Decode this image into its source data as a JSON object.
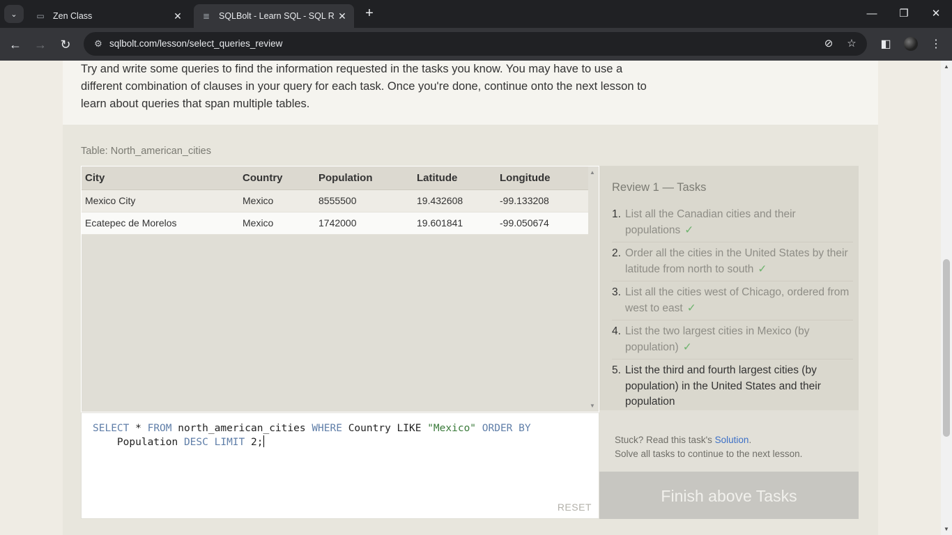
{
  "browser": {
    "tabs": [
      {
        "title": "Zen Class",
        "active": false
      },
      {
        "title": "SQLBolt - Learn SQL - SQL Review",
        "active": true
      }
    ],
    "url": "sqlbolt.com/lesson/select_queries_review"
  },
  "icons": {
    "tab_search": "chevron-down-icon",
    "close": "✕",
    "new_tab": "+",
    "minimize": "—",
    "restore": "❐",
    "window_close": "✕",
    "back": "←",
    "forward": "→",
    "reload": "↻",
    "site_info": "⚙",
    "eye_off": "⊘",
    "star": "☆",
    "side_panel": "◧",
    "menu": "⋮",
    "up_arrow": "▲",
    "down_arrow": "▼"
  },
  "intro": {
    "text": "Try and write some queries to find the information requested in the tasks you know. You may have to use a different combination of clauses in your query for each task. Once you're done, continue onto the next lesson to learn about queries that span multiple tables."
  },
  "results": {
    "label": "Table: North_american_cities",
    "columns": [
      "City",
      "Country",
      "Population",
      "Latitude",
      "Longitude"
    ],
    "rows": [
      [
        "Mexico City",
        "Mexico",
        "8555500",
        "19.432608",
        "-99.133208"
      ],
      [
        "Ecatepec de Morelos",
        "Mexico",
        "1742000",
        "19.601841",
        "-99.050674"
      ]
    ]
  },
  "editor": {
    "query": "SELECT * FROM north_american_cities WHERE Country LIKE \"Mexico\" ORDER BY Population DESC LIMIT 2;",
    "reset_label": "RESET"
  },
  "tasks": {
    "title": "Review 1 — Tasks",
    "items": [
      {
        "num": "1.",
        "text": "List all the Canadian cities and their populations",
        "done": true
      },
      {
        "num": "2.",
        "text": "Order all the cities in the United States by their latitude from north to south",
        "done": true
      },
      {
        "num": "3.",
        "text": "List all the cities west of Chicago, ordered from west to east",
        "done": true
      },
      {
        "num": "4.",
        "text": "List the two largest cities in Mexico (by population)",
        "done": true
      },
      {
        "num": "5.",
        "text": "List the third and fourth largest cities (by population) in the United States and their population",
        "done": false
      }
    ],
    "check_mark": "✓",
    "stuck_prefix": "Stuck? Read this task's ",
    "solution_link": "Solution",
    "stuck_suffix": ".",
    "solve_all": "Solve all tasks to continue to the next lesson.",
    "finish_button": "Finish above Tasks"
  }
}
